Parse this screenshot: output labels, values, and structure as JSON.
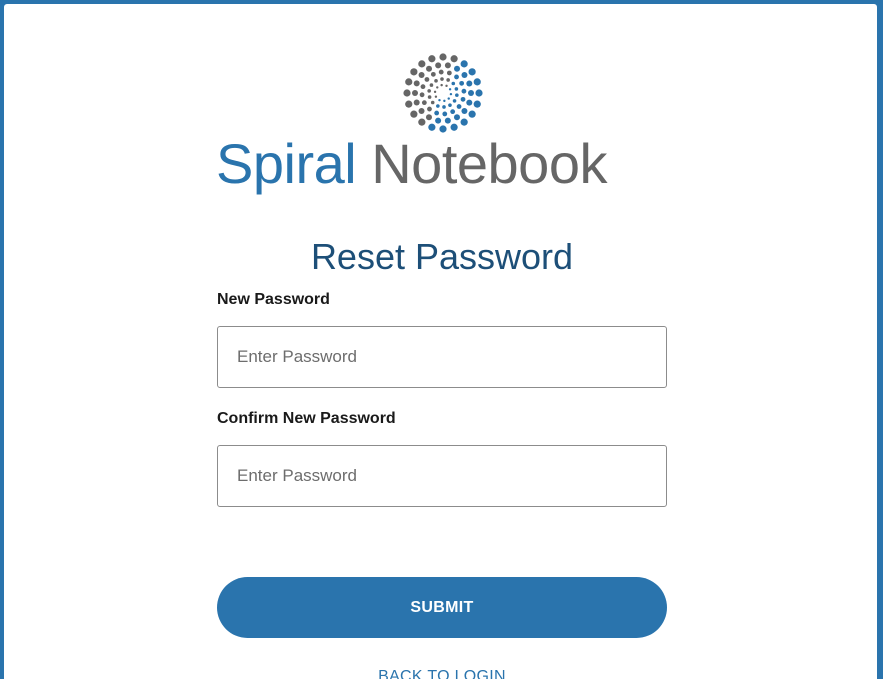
{
  "brand": {
    "name_part1": "Spiral",
    "name_part2": "Notebook",
    "icon": "spiral-dots-logo",
    "colors": {
      "primary": "#2a74ad",
      "secondary": "#666666"
    }
  },
  "page": {
    "title": "Reset Password"
  },
  "form": {
    "new_password": {
      "label": "New Password",
      "placeholder": "Enter Password",
      "value": ""
    },
    "confirm_password": {
      "label": "Confirm New Password",
      "placeholder": "Enter Password",
      "value": ""
    },
    "submit_label": "SUBMIT"
  },
  "links": {
    "back_to_login": "BACK TO LOGIN"
  }
}
